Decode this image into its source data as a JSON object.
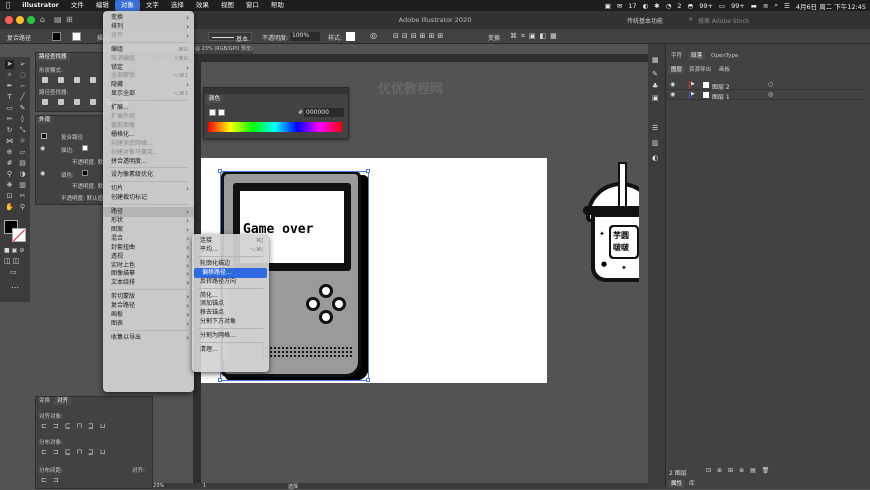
{
  "menubar": {
    "app": "illustrator",
    "items": [
      "文件",
      "编辑",
      "对象",
      "文字",
      "选择",
      "效果",
      "视图",
      "窗口",
      "帮助"
    ],
    "active_index": 2,
    "status": {
      "wechat": "17",
      "count2": "2",
      "battery1": "99+",
      "battery2": "99+",
      "datetime": "4月6日 周二 下午12:45"
    }
  },
  "titlebar": {
    "title": "Adobe Illustrator 2020",
    "workspace": "传统基本功能",
    "search_placeholder": "搜索 Adobe Stock"
  },
  "control_bar": {
    "selection": "复合路径",
    "stroke_label": "描边",
    "stroke_style": "基本",
    "opacity_label": "不透明度:",
    "opacity_value": "100%",
    "style_label": "样式:",
    "transform_label": "变换"
  },
  "doc_tab": "@ 23% (RGB/GPU 预览)",
  "left_panels": {
    "pathfinder_tab": "路径查找器",
    "shape_modes": "形状模式:",
    "pathfinder_label": "路径查找器:",
    "appearance_tab": "外观",
    "appearance_title": "复合路径",
    "stroke": "描边:",
    "opacity1": "不透明度: 默",
    "fill": "填色:",
    "opacity2": "不透明度: 默",
    "opacity3": "不透明度: 默认值",
    "transform_tab": "变换",
    "align_tab": "对齐",
    "align_objects": "对齐对象:",
    "distribute_objects": "分布对象:",
    "distribute_spacing": "分布间距:",
    "align_to": "对齐:"
  },
  "object_menu": {
    "items": [
      {
        "label": "变换",
        "sub": true
      },
      {
        "label": "排列",
        "sub": true
      },
      {
        "label": "对齐",
        "sub": true,
        "dis": true
      },
      {
        "sep": true
      },
      {
        "label": "编组",
        "sc": "⌘G"
      },
      {
        "label": "取消编组",
        "sc": "⇧⌘G",
        "dis": true
      },
      {
        "label": "锁定",
        "sub": true
      },
      {
        "label": "全部解锁",
        "sc": "⌥⌘2",
        "dis": true
      },
      {
        "label": "隐藏",
        "sub": true
      },
      {
        "label": "显示全部",
        "sc": "⌥⌘3"
      },
      {
        "sep": true
      },
      {
        "label": "扩展..."
      },
      {
        "label": "扩展外观",
        "dis": true
      },
      {
        "label": "裁剪图像",
        "dis": true
      },
      {
        "label": "栅格化..."
      },
      {
        "label": "创建渐变网格...",
        "dis": true
      },
      {
        "label": "创建对象马赛克...",
        "dis": true
      },
      {
        "label": "拼合透明度..."
      },
      {
        "sep": true
      },
      {
        "label": "设为像素级优化"
      },
      {
        "sep": true
      },
      {
        "label": "切片",
        "sub": true
      },
      {
        "label": "创建裁切标记"
      },
      {
        "sep": true
      },
      {
        "label": "路径",
        "sub": true,
        "active": true
      },
      {
        "label": "形状",
        "sub": true
      },
      {
        "label": "图案",
        "sub": true
      },
      {
        "label": "混合",
        "sub": true
      },
      {
        "label": "封套扭曲",
        "sub": true
      },
      {
        "label": "透视",
        "sub": true
      },
      {
        "label": "实时上色",
        "sub": true
      },
      {
        "label": "图像描摹",
        "sub": true
      },
      {
        "label": "文本绕排",
        "sub": true
      },
      {
        "sep": true
      },
      {
        "label": "剪切蒙版",
        "sub": true
      },
      {
        "label": "复合路径",
        "sub": true
      },
      {
        "label": "画板",
        "sub": true
      },
      {
        "label": "图表",
        "sub": true
      },
      {
        "sep": true
      },
      {
        "label": "收集以导出",
        "sub": true
      }
    ]
  },
  "path_menu": {
    "items": [
      {
        "label": "连接",
        "sc": "⌘J"
      },
      {
        "label": "平均...",
        "sc": "⌥⌘J"
      },
      {
        "sep": true
      },
      {
        "label": "轮廓化描边"
      },
      {
        "label": "偏移路径...",
        "hl": true
      },
      {
        "label": "反转路径方向"
      },
      {
        "sep": true
      },
      {
        "label": "简化..."
      },
      {
        "label": "添加锚点"
      },
      {
        "label": "移去锚点"
      },
      {
        "label": "分割下方对象"
      },
      {
        "sep": true
      },
      {
        "label": "分割为网格..."
      },
      {
        "sep": true
      },
      {
        "label": "清理..."
      }
    ]
  },
  "color_panel": {
    "tab": "颜色",
    "hex": "000000"
  },
  "artwork": {
    "screen_text": "Game over",
    "cup_text_1": "芋圆",
    "cup_text_2": "啵啵"
  },
  "watermark": "优优教程网",
  "right_panel": {
    "tabs_top": [
      "字符",
      "段落",
      "OpenType"
    ],
    "tabs_layers": [
      "图层",
      "资源导出",
      "画板"
    ],
    "layers": [
      "图层 2",
      "图层 1"
    ],
    "layer_count": "2 图层",
    "bottom_tabs": [
      "属性",
      "库"
    ]
  },
  "status_bar": {
    "zoom": "23%",
    "page": "1",
    "mode": "选择"
  },
  "colors": {
    "menubar": "#1e1e1e",
    "panel": "#424242",
    "canvas": "#535353",
    "highlight": "#2f69e0"
  }
}
